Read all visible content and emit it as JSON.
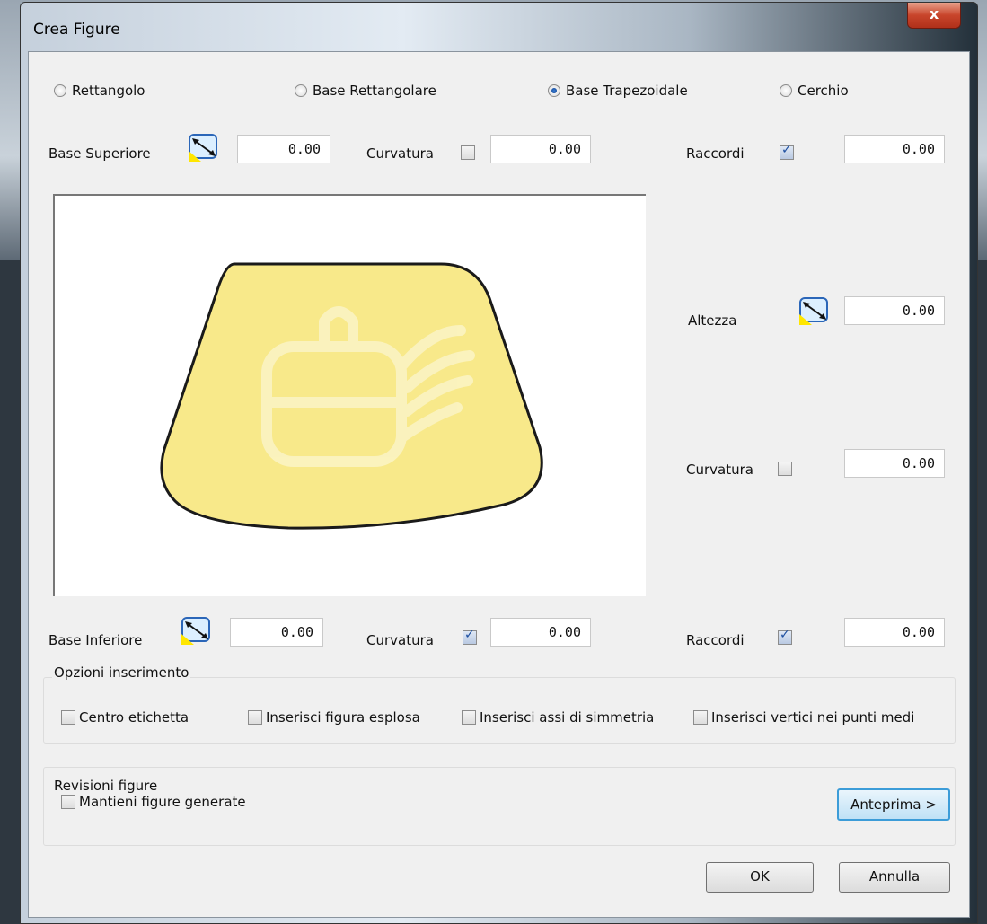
{
  "window": {
    "title": "Crea Figure",
    "close_glyph": "x"
  },
  "shape_type": {
    "options": [
      "Rettangolo",
      "Base Rettangolare",
      "Base Trapezoidale",
      "Cerchio"
    ],
    "selected": "Base Trapezoidale"
  },
  "top_row": {
    "base_label": "Base Superiore",
    "base_value": "0.00",
    "curv_label": "Curvatura",
    "curv_checked": false,
    "curv_value": "0.00",
    "racc_label": "Raccordi",
    "racc_checked": true,
    "racc_value": "0.00"
  },
  "right_col": {
    "altezza_label": "Altezza",
    "altezza_value": "0.00",
    "curv_label": "Curvatura",
    "curv_checked": false,
    "curv_value": "0.00"
  },
  "bottom_row": {
    "base_label": "Base Inferiore",
    "base_value": "0.00",
    "curv_label": "Curvatura",
    "curv_checked": true,
    "curv_value": "0.00",
    "racc_label": "Raccordi",
    "racc_checked": true,
    "racc_value": "0.00"
  },
  "insert_options": {
    "title": "Opzioni inserimento",
    "items": [
      "Centro etichetta",
      "Inserisci figura esplosa",
      "Inserisci assi di simmetria",
      "Inserisci vertici nei punti medi"
    ]
  },
  "revisions": {
    "title": "Revisioni figure",
    "keep_label": "Mantieni figure generate",
    "preview_button": "Anteprima >"
  },
  "footer": {
    "ok": "OK",
    "cancel": "Annulla"
  },
  "colors": {
    "shape_fill": "#f8e98a",
    "shape_stroke": "#1a1a1a",
    "focus_border": "#3c9cd8"
  },
  "icons": [
    "dimension-icon",
    "close-icon",
    "watermark-logo"
  ]
}
